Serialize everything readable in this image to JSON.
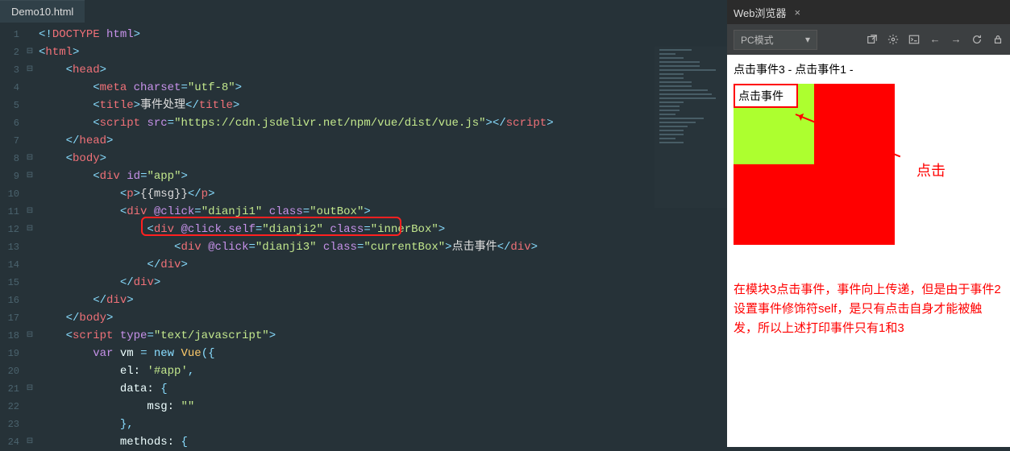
{
  "editor": {
    "tab_name": "Demo10.html",
    "lines": {
      "l1": "<!DOCTYPE html>",
      "l2_tag": "html",
      "l3_tag": "head",
      "l4_tag": "meta",
      "l4_attr": "charset",
      "l4_val": "\"utf-8\"",
      "l5_tag": "title",
      "l5_text": "事件处理",
      "l6_tag": "script",
      "l6_attr": "src",
      "l6_val": "\"https://cdn.jsdelivr.net/npm/vue/dist/vue.js\"",
      "l7_tag": "head",
      "l8_tag": "body",
      "l9_tag": "div",
      "l9_attr": "id",
      "l9_val": "\"app\"",
      "l10_tag": "p",
      "l10_text": "{{msg}}",
      "l11_tag": "div",
      "l11_attr1": "@click",
      "l11_val1": "\"dianji1\"",
      "l11_attr2": "class",
      "l11_val2": "\"outBox\"",
      "l12_tag": "div",
      "l12_attr1": "@click.self",
      "l12_val1": "\"dianji2\"",
      "l12_attr2": "class",
      "l12_val2": "\"innerBox\"",
      "l13_tag": "div",
      "l13_attr1": "@click",
      "l13_val1": "\"dianji3\"",
      "l13_attr2": "class",
      "l13_val2": "\"currentBox\"",
      "l13_text": "点击事件",
      "l14_tag": "div",
      "l15_tag": "div",
      "l16_tag": "div",
      "l17_tag": "body",
      "l18_tag": "script",
      "l18_attr": "type",
      "l18_val": "\"text/javascript\"",
      "l19_var": "var",
      "l19_vm": "vm",
      "l19_new": "new",
      "l19_vue": "Vue",
      "l20_key": "el:",
      "l20_val": "'#app'",
      "l21_key": "data:",
      "l22_key": "msg:",
      "l22_val": "\"\"",
      "l23_brace": "},",
      "l24_key": "methods:"
    },
    "line_numbers": [
      "1",
      "2",
      "3",
      "4",
      "5",
      "6",
      "7",
      "8",
      "9",
      "10",
      "11",
      "12",
      "13",
      "14",
      "15",
      "16",
      "17",
      "18",
      "19",
      "20",
      "21",
      "22",
      "23",
      "24"
    ],
    "fold_markers": [
      "",
      "⊟",
      "⊟",
      "",
      "",
      "",
      "",
      "⊟",
      "⊟",
      "",
      "⊟",
      "⊟",
      "",
      "",
      "",
      "",
      "",
      "⊟",
      "",
      "",
      "⊟",
      "",
      "",
      "⊟"
    ]
  },
  "browser": {
    "tab_title": "Web浏览器",
    "mode": "PC模式",
    "preview": {
      "msg": "点击事件3 - 点击事件1 -",
      "current_box_text": "点击事件"
    },
    "annotation": {
      "click_label": "点击",
      "explanation": "在模块3点击事件，事件向上传递，但是由于事件2设置事件修饰符self，是只有点击自身才能被触发，所以上述打印事件只有1和3"
    }
  }
}
